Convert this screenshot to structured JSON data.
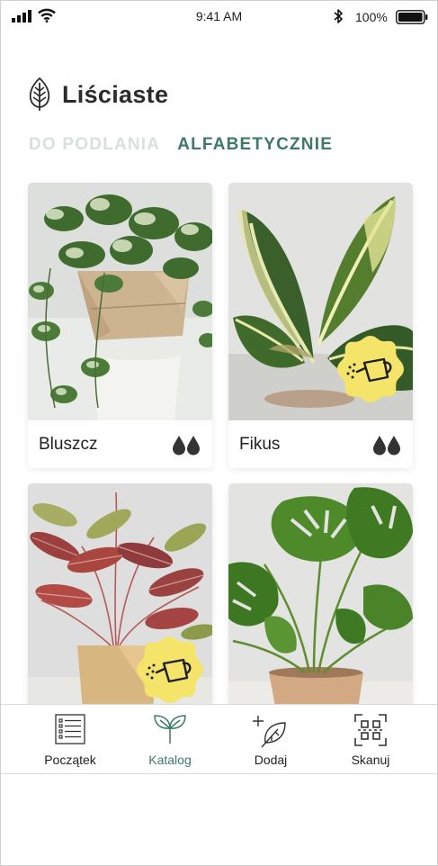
{
  "status_bar": {
    "time": "9:41 AM",
    "battery_percent": "100%",
    "icons": [
      "signal-icon",
      "wifi-icon",
      "bluetooth-icon",
      "battery-icon"
    ]
  },
  "header": {
    "icon": "leaf-icon",
    "title": "Liściaste"
  },
  "tabs": [
    {
      "label": "DO PODLANIA",
      "active": false
    },
    {
      "label": "ALFABETYCZNIE",
      "active": true
    }
  ],
  "plants": [
    {
      "name": "Bluszcz",
      "water_level": 2,
      "needs_watering": false
    },
    {
      "name": "Fikus",
      "water_level": 2,
      "needs_watering": true
    },
    {
      "name": "",
      "water_level": null,
      "needs_watering": true
    },
    {
      "name": "",
      "water_level": null,
      "needs_watering": false
    }
  ],
  "bottom_nav": [
    {
      "label": "Początek",
      "icon": "list-icon",
      "active": false
    },
    {
      "label": "Katalog",
      "icon": "sprout-icon",
      "active": true
    },
    {
      "label": "Dodaj",
      "icon": "add-leaf-icon",
      "active": false
    },
    {
      "label": "Skanuj",
      "icon": "qr-scan-icon",
      "active": false
    }
  ],
  "colors": {
    "accent": "#3d7a62",
    "tab_inactive": "#d6e1de",
    "badge": "#f5e46a",
    "drop": "#333333"
  }
}
